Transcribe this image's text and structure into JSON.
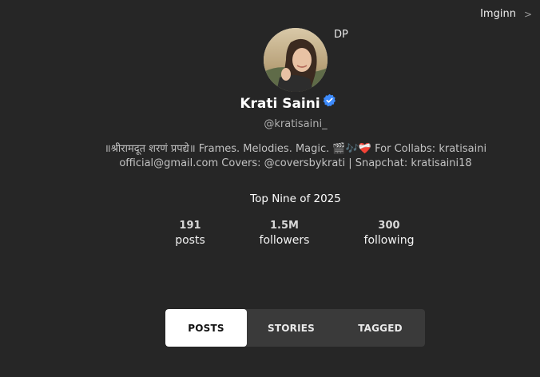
{
  "nav": {
    "site_label": "Imginn",
    "chevron": ">"
  },
  "profile": {
    "dp_label": "DP",
    "name": "Krati Saini",
    "username": "@kratisaini_",
    "bio": "॥श्रीरामदूत शरणं प्रपद्ये॥ Frames. Melodies. Magic. 🎬🎶❤️‍🩹 For Collabs: kratisainiofficial@gmail.com Covers: @coversbykrati | Snapchat: kratisaini18",
    "top_nine": "Top Nine of 2025"
  },
  "stats": [
    {
      "value": "191",
      "label": "posts"
    },
    {
      "value": "1.5M",
      "label": "followers"
    },
    {
      "value": "300",
      "label": "following"
    }
  ],
  "tabs": [
    {
      "label": "POSTS",
      "active": true
    },
    {
      "label": "STORIES",
      "active": false
    },
    {
      "label": "TAGGED",
      "active": false
    }
  ],
  "colors": {
    "background": "#262626",
    "verified": "#3d8bfd",
    "tab_bar": "#3a3a3a",
    "tab_active": "#ffffff"
  }
}
